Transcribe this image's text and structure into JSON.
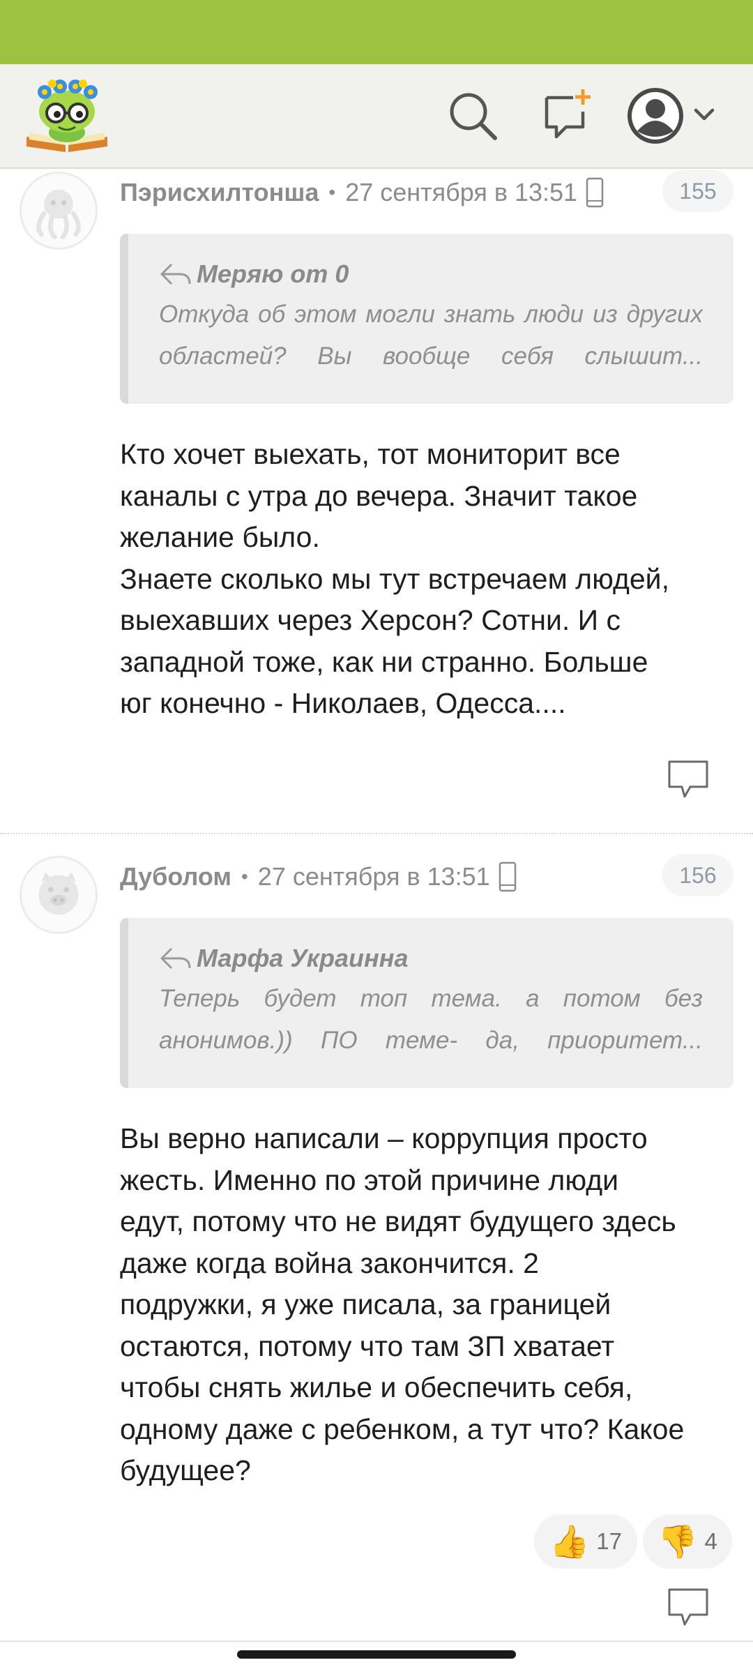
{
  "header": {
    "logo_icon": "bookworm-logo",
    "search_icon": "search-icon",
    "new_post_icon": "new-post-icon",
    "profile_icon": "user-avatar-icon",
    "dropdown_icon": "chevron-down-icon"
  },
  "comments": [
    {
      "author": "Пэрисхилтонша",
      "separator": "•",
      "date": "27 сентября в 13:51",
      "device_icon": "mobile-phone-icon",
      "number": "155",
      "quote": {
        "author": "Меряю от 0",
        "text": "Откуда об этом могли знать люди из других областей? Вы вообще себя слышит..."
      },
      "body": [
        "Кто хочет выехать, тот мониторит все",
        "каналы с утра до вечера. Значит такое",
        "желание было.",
        "Знаете сколько мы тут встречаем людей,",
        "выехавших через Херсон? Сотни. И с",
        "западной тоже, как ни странно. Больше",
        "юг конечно - Николаев, Одесса...."
      ],
      "reply_icon": "reply-bubble-icon"
    },
    {
      "author": "Дуболом",
      "separator": "•",
      "date": "27 сентября в 13:51",
      "device_icon": "mobile-phone-icon",
      "number": "156",
      "quote": {
        "author": "Марфа Украинна",
        "text": "Теперь будет топ тема. а потом без анонимов.)) ПО теме- да, приоритет..."
      },
      "body": [
        "Вы верно написали – коррупция просто",
        "жесть. Именно по этой причине люди",
        "едут, потому что не видят будущего здесь",
        "даже когда война закончится. 2",
        "подружки, я уже писала, за границей",
        "остаются, потому что там ЗП хватает",
        "чтобы снять жилье и обеспечить себя,",
        "одному даже с ребенком, а тут что? Какое",
        "будущее?"
      ],
      "likes": {
        "icon": "👍",
        "count": "17"
      },
      "dislikes": {
        "icon": "👎",
        "count": "4"
      },
      "reply_icon": "reply-bubble-icon"
    }
  ],
  "colors": {
    "status_bar": "#9dc23f",
    "header_bg": "#f1f1ed",
    "quote_bg": "#efefef",
    "meta_text": "#8b8b8b",
    "badge_text": "#8d9aa6",
    "accent_orange": "#f39a2b"
  }
}
